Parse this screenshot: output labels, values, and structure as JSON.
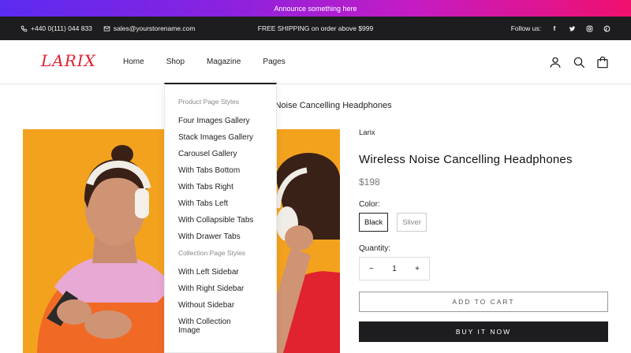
{
  "announcement": "Announce something here",
  "topbar": {
    "phone": "+440 0(111) 044 833",
    "email": "sales@yourstorename.com",
    "shipping": "FREE SHIPPING on order above $999",
    "follow_label": "Follow us:",
    "social_icons": [
      "facebook-icon",
      "twitter-icon",
      "instagram-icon",
      "pinterest-icon"
    ]
  },
  "header": {
    "logo": "LARIX",
    "nav": [
      "Home",
      "Shop",
      "Magazine",
      "Pages"
    ]
  },
  "breadcrumb": "Wireless Noise Cancelling Headphones",
  "product": {
    "brand": "Larix",
    "title": "Wireless Noise Cancelling Headphones",
    "price": "$198",
    "color_label": "Color:",
    "colors": [
      "Black",
      "Sliver"
    ],
    "selected_color": "Black",
    "quantity_label": "Quantity:",
    "quantity": "1",
    "minus": "−",
    "plus": "+",
    "add_to_cart": "ADD TO CART",
    "buy_now": "BUY IT NOW"
  },
  "dropdown": {
    "product_heading": "Product Page Styles",
    "product_items": [
      "Four Images Gallery",
      "Stack Images Gallery",
      "Carousel Gallery",
      "With Tabs Bottom",
      "With Tabs Right",
      "With Tabs Left",
      "With Collapsible Tabs",
      "With Drawer Tabs"
    ],
    "collection_heading": "Collection Page Styles",
    "collection_items": [
      "With Left Sidebar",
      "With Right Sidebar",
      "Without Sidebar",
      "With Collection Image"
    ]
  },
  "colors": {
    "logo": "#e0202e",
    "image_bg": "#f3a21e",
    "dark": "#1d1d1f"
  }
}
